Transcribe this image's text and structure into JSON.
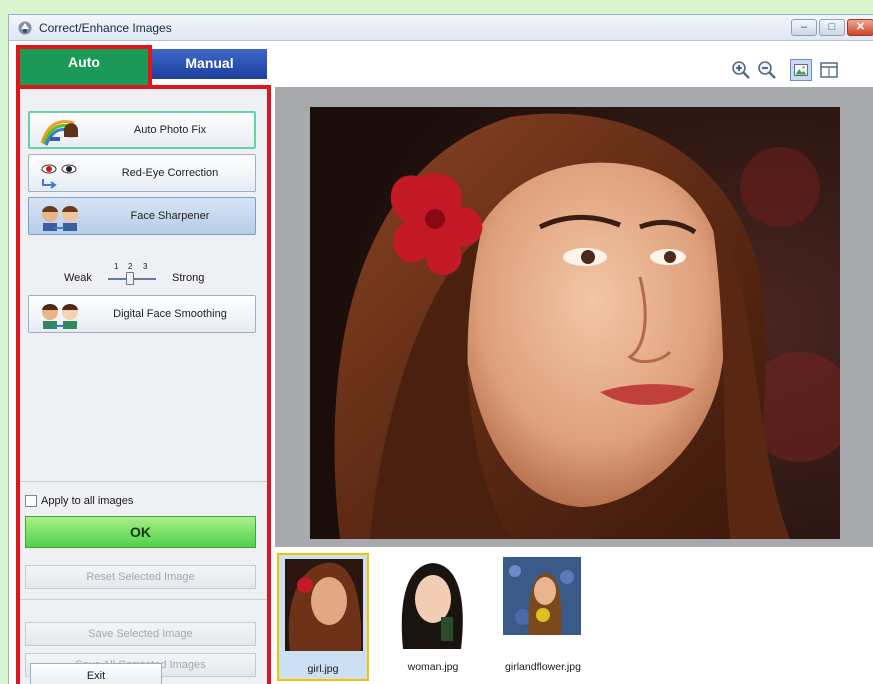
{
  "window": {
    "title": "Correct/Enhance Images",
    "controls": {
      "minimize": "–",
      "maximize": "□",
      "close": "✕"
    }
  },
  "tabs": [
    {
      "label": "Auto",
      "selected": true
    },
    {
      "label": "Manual",
      "selected": false
    }
  ],
  "functions": {
    "auto_photo_fix": "Auto Photo Fix",
    "red_eye": "Red-Eye Correction",
    "face_sharpener": "Face Sharpener",
    "digital_face_smoothing": "Digital Face Smoothing"
  },
  "slider": {
    "min_label": "Weak",
    "max_label": "Strong",
    "ticks": [
      "1",
      "2",
      "3"
    ],
    "value": 2
  },
  "apply_all": {
    "label": "Apply to all images",
    "checked": false
  },
  "buttons": {
    "ok": "OK",
    "reset_selected": "Reset Selected Image",
    "save_selected": "Save Selected Image",
    "save_all": "Save All Corrected Images",
    "exit": "Exit"
  },
  "thumbnails": [
    {
      "caption": "girl.jpg",
      "selected": true
    },
    {
      "caption": "woman.jpg",
      "selected": false
    },
    {
      "caption": "girlandflower.jpg",
      "selected": false
    }
  ],
  "colors": {
    "highlight_outline": "#e0141c",
    "auto_tab": "#1a9a56",
    "manual_tab": "#1b3f9c",
    "ok_button": "#4fd04a",
    "selected_thumb_border": "#f0c400"
  },
  "icons": {
    "app": "app-logo-icon",
    "zoom_in": "zoom-in-icon",
    "zoom_out": "zoom-out-icon",
    "whole_image": "whole-image-view-icon",
    "compare": "compare-view-icon"
  }
}
